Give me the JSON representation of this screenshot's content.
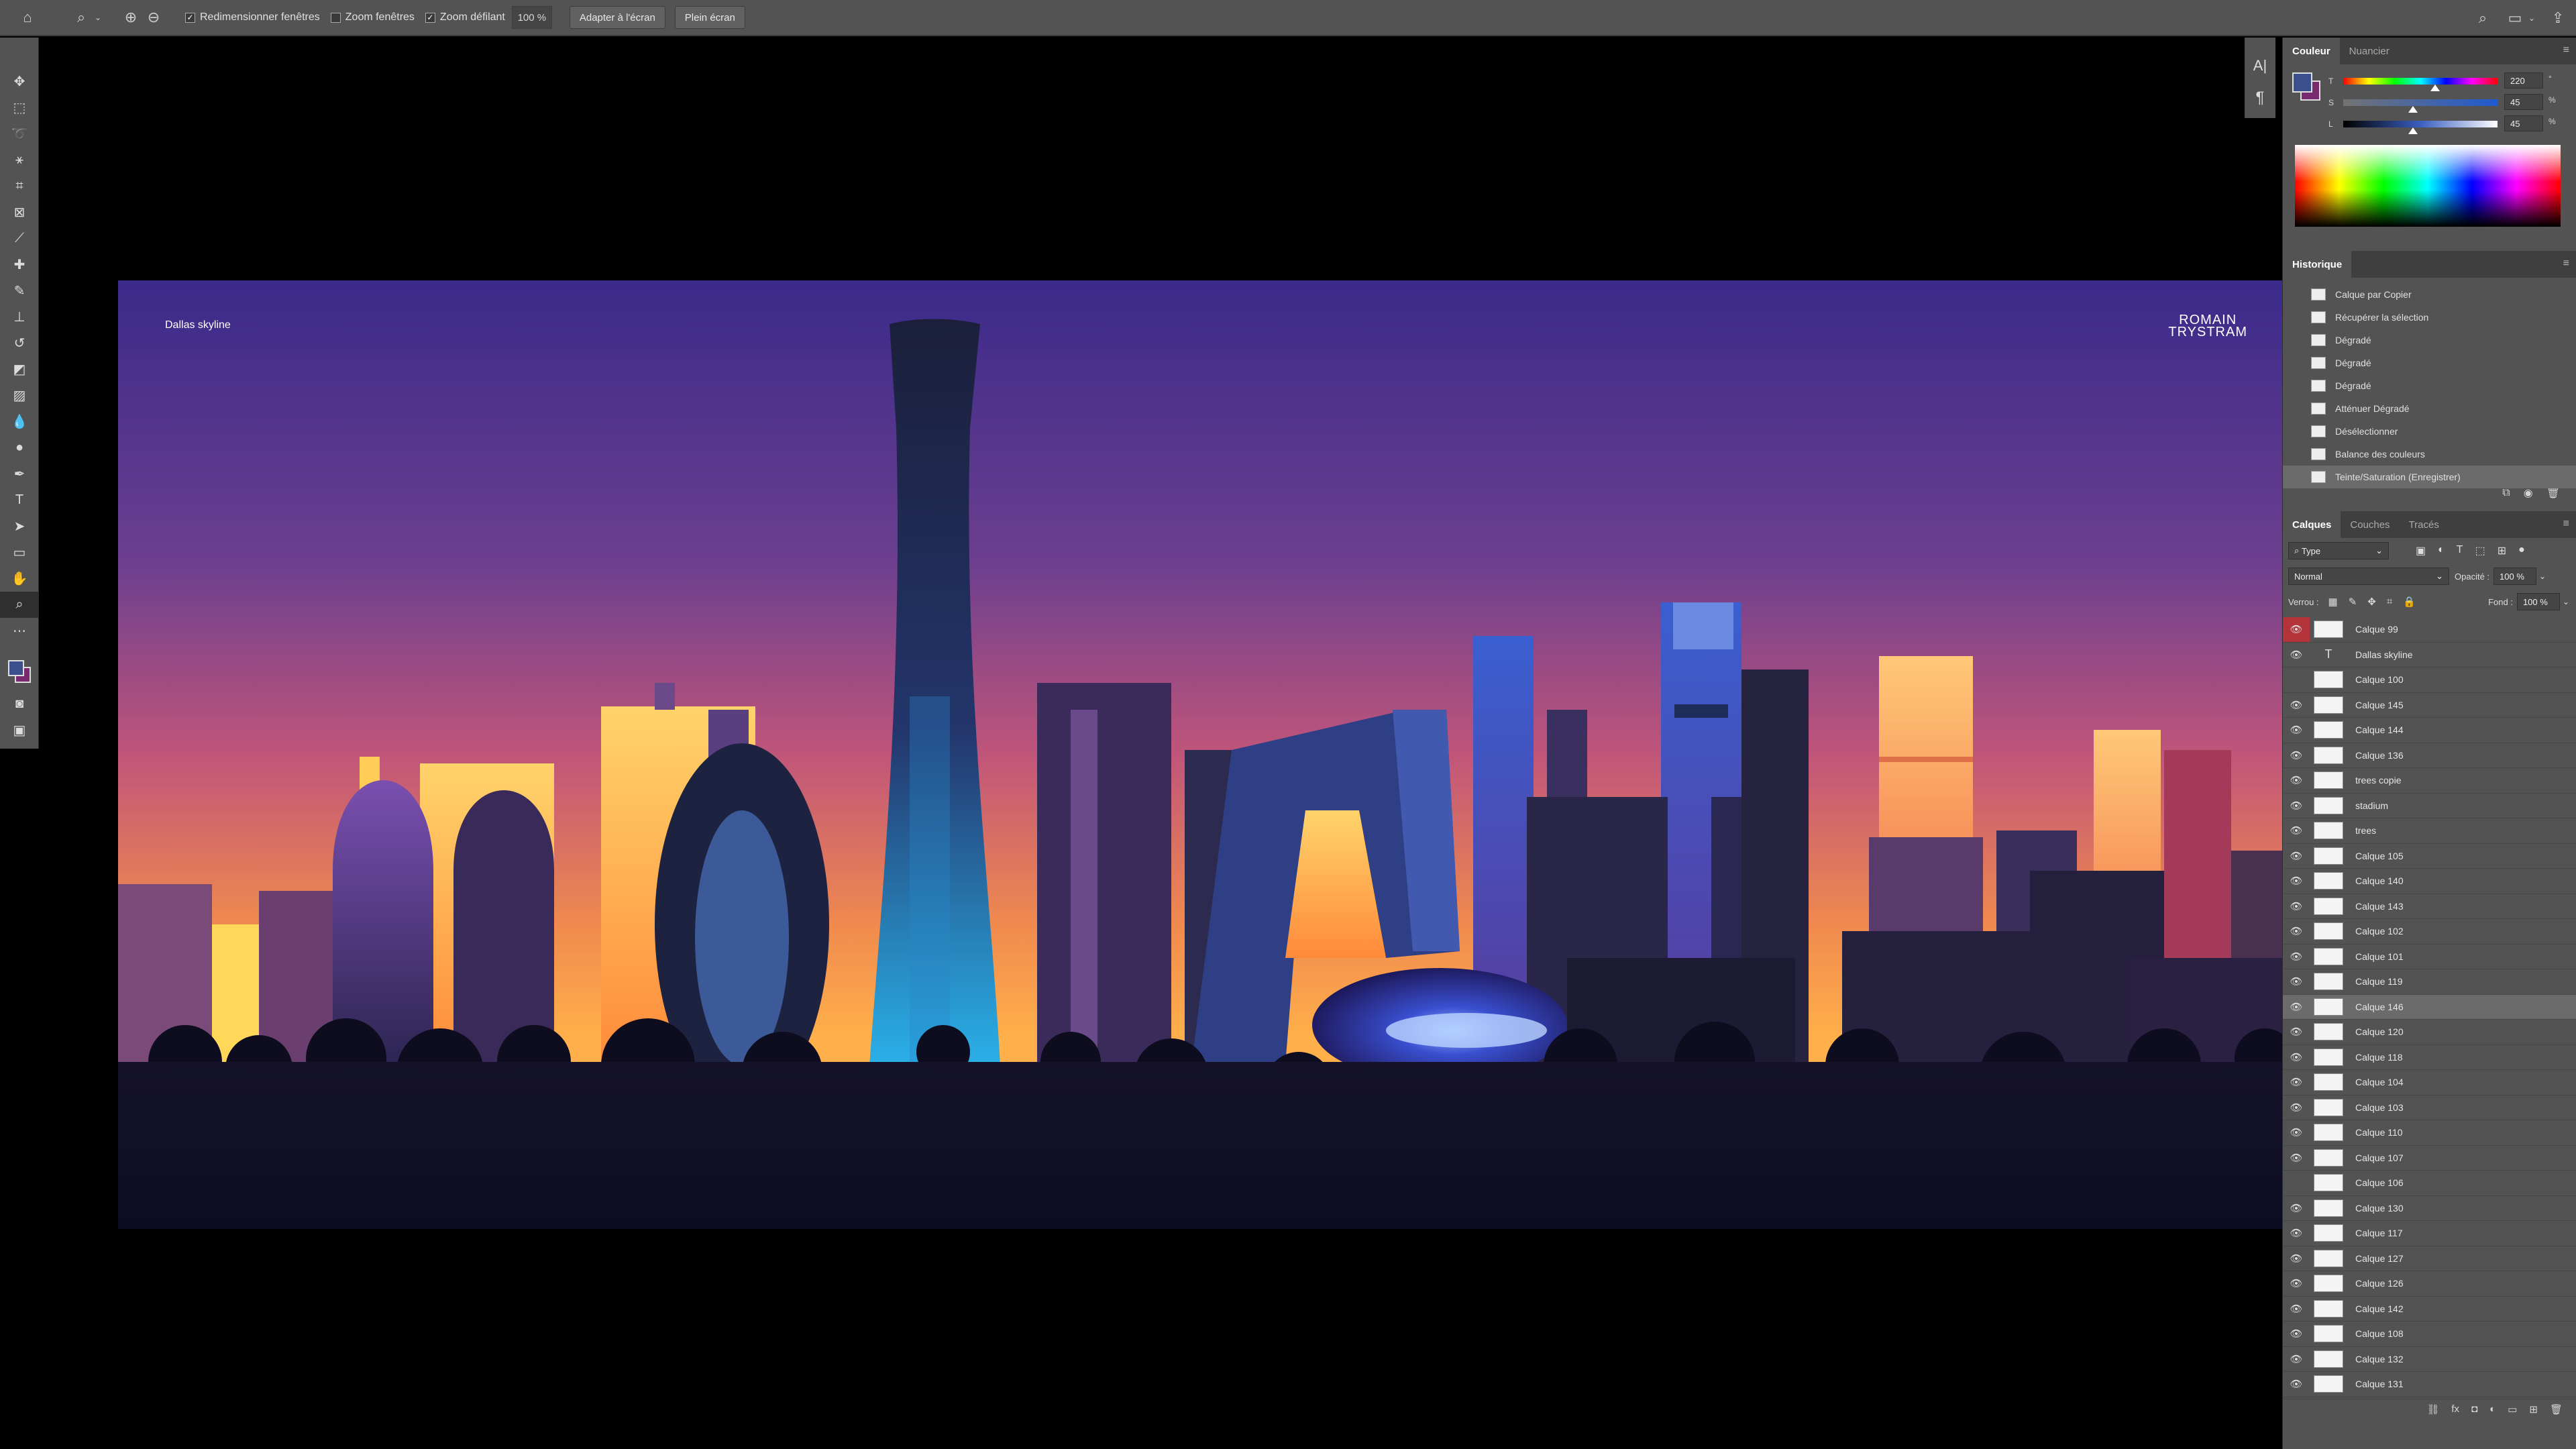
{
  "options_bar": {
    "resize_windows": "Redimensionner fenêtres",
    "zoom_windows": "Zoom fenêtres",
    "scrubby_zoom": "Zoom défilant",
    "zoom_value": "100 %",
    "fit_screen": "Adapter à l'écran",
    "full_screen": "Plein écran"
  },
  "artboard": {
    "caption": "Dallas skyline",
    "brand_line1": "ROMAIN",
    "brand_line2": "TRYSTRAM"
  },
  "color_panel": {
    "tab_color": "Couleur",
    "tab_swatches": "Nuancier",
    "t_label": "T",
    "t_value": "220",
    "t_unit": "°",
    "s_label": "S",
    "s_value": "45",
    "s_unit": "%",
    "l_label": "L",
    "l_value": "45",
    "l_unit": "%",
    "foreground": "#3a4f8c",
    "background": "#7a2a6e"
  },
  "history_panel": {
    "tab": "Historique",
    "items": [
      "Calque par Copier",
      "Récupérer la sélection",
      "Dégradé",
      "Dégradé",
      "Dégradé",
      "Atténuer Dégradé",
      "Désélectionner",
      "Balance des couleurs",
      "Teinte/Saturation (Enregistrer)"
    ]
  },
  "layers_panel": {
    "tab_layers": "Calques",
    "tab_channels": "Couches",
    "tab_paths": "Tracés",
    "filter": "Type",
    "blend_mode": "Normal",
    "opacity_label": "Opacité :",
    "opacity_value": "100 %",
    "lock_label": "Verrou :",
    "fill_label": "Fond :",
    "fill_value": "100 %",
    "layers": [
      {
        "name": "Calque 99",
        "visible": true,
        "kind": "pixel"
      },
      {
        "name": "Dallas skyline",
        "visible": true,
        "kind": "text"
      },
      {
        "name": "Calque 100",
        "visible": false,
        "kind": "pixel"
      },
      {
        "name": "Calque 145",
        "visible": true,
        "kind": "pixel"
      },
      {
        "name": "Calque 144",
        "visible": true,
        "kind": "pixel"
      },
      {
        "name": "Calque 136",
        "visible": true,
        "kind": "pixel"
      },
      {
        "name": "trees copie",
        "visible": true,
        "kind": "pixel"
      },
      {
        "name": "stadium",
        "visible": true,
        "kind": "pixel"
      },
      {
        "name": "trees",
        "visible": true,
        "kind": "pixel"
      },
      {
        "name": "Calque 105",
        "visible": true,
        "kind": "pixel"
      },
      {
        "name": "Calque 140",
        "visible": true,
        "kind": "pixel"
      },
      {
        "name": "Calque 143",
        "visible": true,
        "kind": "pixel"
      },
      {
        "name": "Calque 102",
        "visible": true,
        "kind": "pixel"
      },
      {
        "name": "Calque 101",
        "visible": true,
        "kind": "pixel"
      },
      {
        "name": "Calque 119",
        "visible": true,
        "kind": "pixel"
      },
      {
        "name": "Calque 146",
        "visible": true,
        "kind": "pixel",
        "selected": true
      },
      {
        "name": "Calque 120",
        "visible": true,
        "kind": "pixel"
      },
      {
        "name": "Calque 118",
        "visible": true,
        "kind": "pixel"
      },
      {
        "name": "Calque 104",
        "visible": true,
        "kind": "pixel"
      },
      {
        "name": "Calque 103",
        "visible": true,
        "kind": "pixel"
      },
      {
        "name": "Calque 110",
        "visible": true,
        "kind": "pixel"
      },
      {
        "name": "Calque 107",
        "visible": true,
        "kind": "pixel"
      },
      {
        "name": "Calque 106",
        "visible": false,
        "kind": "pixel"
      },
      {
        "name": "Calque 130",
        "visible": true,
        "kind": "pixel"
      },
      {
        "name": "Calque 117",
        "visible": true,
        "kind": "pixel"
      },
      {
        "name": "Calque 127",
        "visible": true,
        "kind": "pixel"
      },
      {
        "name": "Calque 126",
        "visible": true,
        "kind": "pixel"
      },
      {
        "name": "Calque 142",
        "visible": true,
        "kind": "pixel"
      },
      {
        "name": "Calque 108",
        "visible": true,
        "kind": "pixel"
      },
      {
        "name": "Calque 132",
        "visible": true,
        "kind": "pixel"
      },
      {
        "name": "Calque 131",
        "visible": true,
        "kind": "pixel"
      }
    ]
  },
  "mini_panel": {
    "char_icon": "A|",
    "para_icon": "¶"
  }
}
